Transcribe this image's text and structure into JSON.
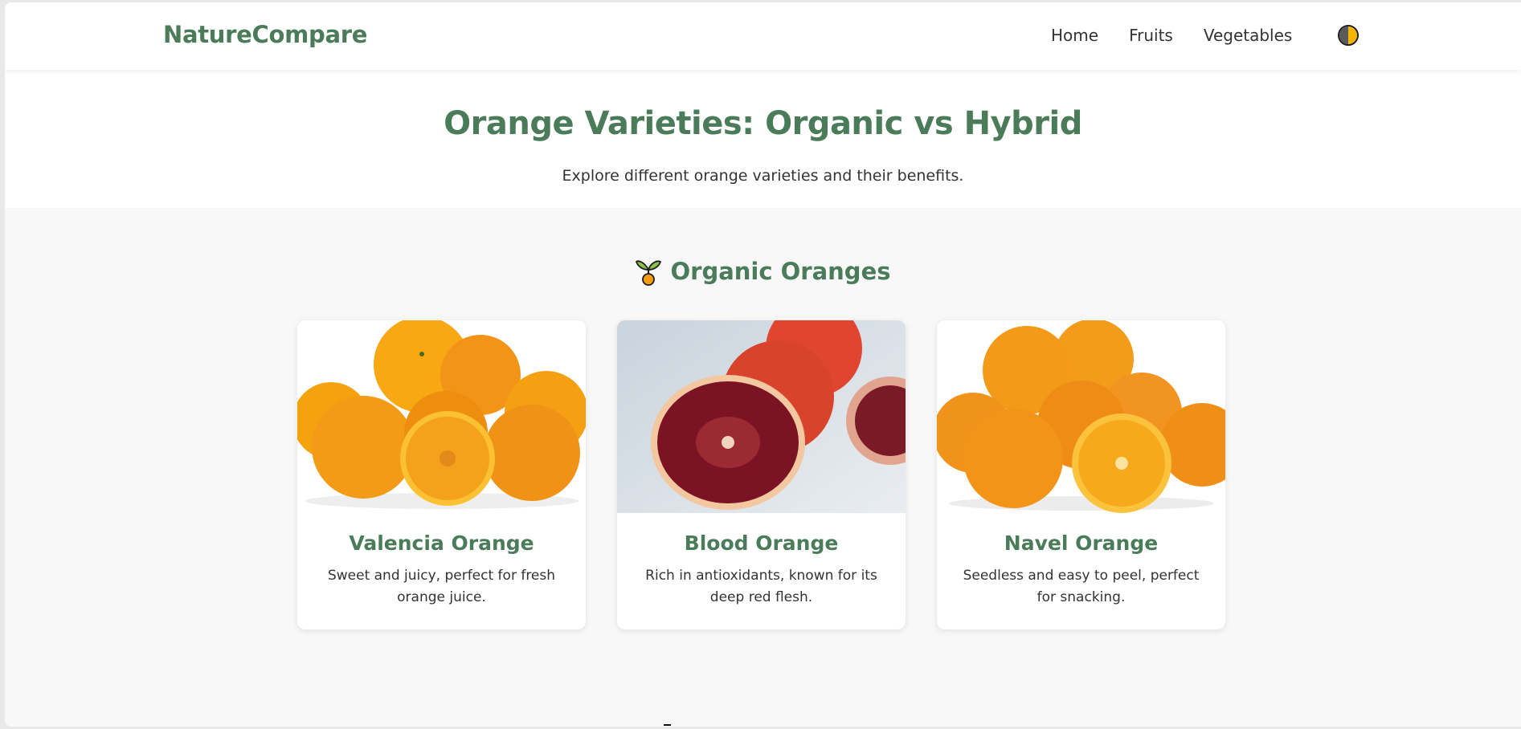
{
  "theme": {
    "primary": "#4a7c59",
    "accent": "#f5b400"
  },
  "nav": {
    "brand": "NatureCompare",
    "links": [
      "Home",
      "Fruits",
      "Vegetables"
    ],
    "theme_toggle_icon": "theme-toggle-icon"
  },
  "hero": {
    "title": "Orange Varieties: Organic vs Hybrid",
    "subtitle": "Explore different orange varieties and their benefits."
  },
  "section": {
    "icon": "sprout-icon",
    "title": "Organic Oranges"
  },
  "cards": [
    {
      "title": "Valencia Orange",
      "description": "Sweet and juicy, perfect for fresh orange juice."
    },
    {
      "title": "Blood Orange",
      "description": "Rich in antioxidants, known for its deep red flesh."
    },
    {
      "title": "Navel Orange",
      "description": "Seedless and easy to peel, perfect for snacking."
    }
  ]
}
